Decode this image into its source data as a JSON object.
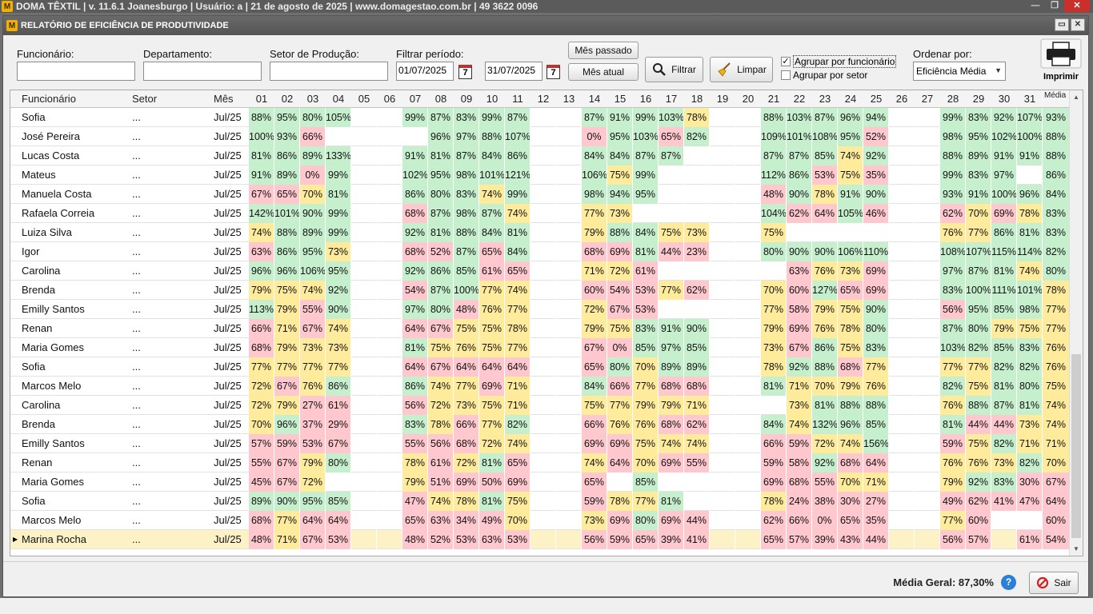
{
  "app_bar": {
    "logo": "M",
    "title": "DOMA TÊXTIL | v. 11.6.1 Joanesburgo | Usuário: a | 21 de agosto de 2025 | www.domagestao.com.br | 49 3622 0096"
  },
  "window": {
    "title": "RELATÓRIO DE EFICIÊNCIA DE PRODUTIVIDADE"
  },
  "filters": {
    "funcionario_label": "Funcionário:",
    "funcionario_value": "",
    "departamento_label": "Departamento:",
    "departamento_value": "",
    "setor_label": "Setor de Produção:",
    "setor_value": "",
    "periodo_label": "Filtrar período:",
    "date_from": "01/07/2025",
    "date_to": "31/07/2025",
    "cal_glyph": "7",
    "mes_passado": "Mês passado",
    "mes_atual": "Mês atual",
    "filtrar": "Filtrar",
    "limpar": "Limpar",
    "agrupar_func": "Agrupar por funcionário",
    "agrupar_func_checked": "✓",
    "agrupar_setor": "Agrupar por setor",
    "ordenar_label": "Ordenar por:",
    "ordenar_value": "Eficiência Média",
    "imprimir": "Imprimir"
  },
  "grid": {
    "headers": {
      "funcionario": "Funcionário",
      "setor": "Setor",
      "mes": "Mês",
      "media": "Média"
    },
    "days": [
      "01",
      "02",
      "03",
      "04",
      "05",
      "06",
      "07",
      "08",
      "09",
      "10",
      "11",
      "12",
      "13",
      "14",
      "15",
      "16",
      "17",
      "18",
      "19",
      "20",
      "21",
      "22",
      "23",
      "24",
      "25",
      "26",
      "27",
      "28",
      "29",
      "30",
      "31"
    ],
    "rows": [
      {
        "name": "Sofia",
        "setor": "...",
        "mes": "Jul/25",
        "days": [
          "88%",
          "95%",
          "80%",
          "105%",
          "",
          "",
          "99%",
          "87%",
          "83%",
          "99%",
          "87%",
          "",
          "",
          "87%",
          "91%",
          "99%",
          "103%",
          "78%",
          "",
          "",
          "88%",
          "103%",
          "87%",
          "96%",
          "94%",
          "",
          "",
          "99%",
          "83%",
          "92%",
          "107%"
        ],
        "media": "93%"
      },
      {
        "name": "José Pereira",
        "setor": "...",
        "mes": "Jul/25",
        "days": [
          "100%",
          "93%",
          "66%",
          "",
          "",
          "",
          "",
          "96%",
          "97%",
          "88%",
          "107%",
          "",
          "",
          "0%",
          "95%",
          "103%",
          "65%",
          "82%",
          "",
          "",
          "109%",
          "101%",
          "108%",
          "95%",
          "52%",
          "",
          "",
          "98%",
          "95%",
          "102%",
          "100%"
        ],
        "media": "88%"
      },
      {
        "name": "Lucas Costa",
        "setor": "...",
        "mes": "Jul/25",
        "days": [
          "81%",
          "86%",
          "89%",
          "133%",
          "",
          "",
          "91%",
          "81%",
          "87%",
          "84%",
          "86%",
          "",
          "",
          "84%",
          "84%",
          "87%",
          "87%",
          "",
          "",
          "",
          "87%",
          "87%",
          "85%",
          "74%",
          "92%",
          "",
          "",
          "88%",
          "89%",
          "91%",
          "91%"
        ],
        "media": "88%"
      },
      {
        "name": "Mateus",
        "setor": "...",
        "mes": "Jul/25",
        "days": [
          "91%",
          "89%",
          "0%",
          "99%",
          "",
          "",
          "102%",
          "95%",
          "98%",
          "101%",
          "121%",
          "",
          "",
          "106%",
          "75%",
          "99%",
          "",
          "",
          "",
          "",
          "112%",
          "86%",
          "53%",
          "75%",
          "35%",
          "",
          "",
          "99%",
          "83%",
          "97%",
          ""
        ],
        "media": "86%"
      },
      {
        "name": "Manuela Costa",
        "setor": "...",
        "mes": "Jul/25",
        "days": [
          "67%",
          "65%",
          "70%",
          "81%",
          "",
          "",
          "86%",
          "80%",
          "83%",
          "74%",
          "99%",
          "",
          "",
          "98%",
          "94%",
          "95%",
          "",
          "",
          "",
          "",
          "48%",
          "90%",
          "78%",
          "91%",
          "90%",
          "",
          "",
          "93%",
          "91%",
          "100%",
          "96%"
        ],
        "media": "84%"
      },
      {
        "name": "Rafaela Correia",
        "setor": "...",
        "mes": "Jul/25",
        "days": [
          "142%",
          "101%",
          "90%",
          "99%",
          "",
          "",
          "68%",
          "87%",
          "98%",
          "87%",
          "74%",
          "",
          "",
          "77%",
          "73%",
          "",
          "",
          "",
          "",
          "",
          "104%",
          "62%",
          "64%",
          "105%",
          "46%",
          "",
          "",
          "62%",
          "70%",
          "69%",
          "78%"
        ],
        "media": "83%"
      },
      {
        "name": "Luiza Silva",
        "setor": "...",
        "mes": "Jul/25",
        "days": [
          "74%",
          "88%",
          "89%",
          "99%",
          "",
          "",
          "92%",
          "81%",
          "88%",
          "84%",
          "81%",
          "",
          "",
          "79%",
          "88%",
          "84%",
          "75%",
          "73%",
          "",
          "",
          "75%",
          "",
          "",
          "",
          "",
          "",
          "",
          "76%",
          "77%",
          "86%",
          "81%"
        ],
        "media": "83%"
      },
      {
        "name": "Igor",
        "setor": "...",
        "mes": "Jul/25",
        "days": [
          "63%",
          "86%",
          "95%",
          "73%",
          "",
          "",
          "68%",
          "52%",
          "87%",
          "65%",
          "84%",
          "",
          "",
          "68%",
          "69%",
          "81%",
          "44%",
          "23%",
          "",
          "",
          "80%",
          "90%",
          "90%",
          "106%",
          "110%",
          "",
          "",
          "108%",
          "107%",
          "115%",
          "114%"
        ],
        "media": "82%"
      },
      {
        "name": "Carolina",
        "setor": "...",
        "mes": "Jul/25",
        "days": [
          "96%",
          "96%",
          "106%",
          "95%",
          "",
          "",
          "92%",
          "86%",
          "85%",
          "61%",
          "65%",
          "",
          "",
          "71%",
          "72%",
          "61%",
          "",
          "",
          "",
          "",
          "",
          "63%",
          "76%",
          "73%",
          "69%",
          "",
          "",
          "97%",
          "87%",
          "81%",
          "74%"
        ],
        "media": "80%"
      },
      {
        "name": "Brenda",
        "setor": "...",
        "mes": "Jul/25",
        "days": [
          "79%",
          "75%",
          "74%",
          "92%",
          "",
          "",
          "54%",
          "87%",
          "100%",
          "77%",
          "74%",
          "",
          "",
          "60%",
          "54%",
          "53%",
          "77%",
          "62%",
          "",
          "",
          "70%",
          "60%",
          "127%",
          "65%",
          "69%",
          "",
          "",
          "83%",
          "100%",
          "111%",
          "101%"
        ],
        "media": "78%"
      },
      {
        "name": "Emilly Santos",
        "setor": "...",
        "mes": "Jul/25",
        "days": [
          "113%",
          "79%",
          "55%",
          "90%",
          "",
          "",
          "97%",
          "80%",
          "48%",
          "76%",
          "77%",
          "",
          "",
          "72%",
          "67%",
          "53%",
          "",
          "",
          "",
          "",
          "77%",
          "58%",
          "79%",
          "75%",
          "90%",
          "",
          "",
          "56%",
          "95%",
          "85%",
          "98%"
        ],
        "media": "77%"
      },
      {
        "name": "Renan",
        "setor": "...",
        "mes": "Jul/25",
        "days": [
          "66%",
          "71%",
          "67%",
          "74%",
          "",
          "",
          "64%",
          "67%",
          "75%",
          "75%",
          "78%",
          "",
          "",
          "79%",
          "75%",
          "83%",
          "91%",
          "90%",
          "",
          "",
          "79%",
          "69%",
          "76%",
          "78%",
          "80%",
          "",
          "",
          "87%",
          "80%",
          "79%",
          "75%"
        ],
        "media": "77%"
      },
      {
        "name": "Maria Gomes",
        "setor": "...",
        "mes": "Jul/25",
        "days": [
          "68%",
          "79%",
          "73%",
          "73%",
          "",
          "",
          "81%",
          "75%",
          "76%",
          "75%",
          "77%",
          "",
          "",
          "67%",
          "0%",
          "85%",
          "97%",
          "85%",
          "",
          "",
          "73%",
          "67%",
          "86%",
          "75%",
          "83%",
          "",
          "",
          "103%",
          "82%",
          "85%",
          "83%"
        ],
        "media": "76%"
      },
      {
        "name": "Sofia",
        "setor": "...",
        "mes": "Jul/25",
        "days": [
          "77%",
          "77%",
          "77%",
          "77%",
          "",
          "",
          "64%",
          "67%",
          "64%",
          "64%",
          "64%",
          "",
          "",
          "65%",
          "80%",
          "70%",
          "89%",
          "89%",
          "",
          "",
          "78%",
          "92%",
          "88%",
          "68%",
          "77%",
          "",
          "",
          "77%",
          "77%",
          "82%",
          "82%"
        ],
        "media": "76%"
      },
      {
        "name": "Marcos Melo",
        "setor": "...",
        "mes": "Jul/25",
        "days": [
          "72%",
          "67%",
          "76%",
          "86%",
          "",
          "",
          "86%",
          "74%",
          "77%",
          "69%",
          "71%",
          "",
          "",
          "84%",
          "66%",
          "77%",
          "68%",
          "68%",
          "",
          "",
          "81%",
          "71%",
          "70%",
          "79%",
          "76%",
          "",
          "",
          "82%",
          "75%",
          "81%",
          "80%"
        ],
        "media": "75%"
      },
      {
        "name": "Carolina",
        "setor": "...",
        "mes": "Jul/25",
        "days": [
          "72%",
          "79%",
          "27%",
          "61%",
          "",
          "",
          "56%",
          "72%",
          "73%",
          "75%",
          "71%",
          "",
          "",
          "75%",
          "77%",
          "79%",
          "79%",
          "71%",
          "",
          "",
          "",
          "73%",
          "81%",
          "88%",
          "88%",
          "",
          "",
          "76%",
          "88%",
          "87%",
          "81%"
        ],
        "media": "74%"
      },
      {
        "name": "Brenda",
        "setor": "...",
        "mes": "Jul/25",
        "days": [
          "70%",
          "96%",
          "37%",
          "29%",
          "",
          "",
          "83%",
          "78%",
          "66%",
          "77%",
          "82%",
          "",
          "",
          "66%",
          "76%",
          "76%",
          "68%",
          "62%",
          "",
          "",
          "84%",
          "74%",
          "132%",
          "96%",
          "85%",
          "",
          "",
          "81%",
          "44%",
          "44%",
          "73%"
        ],
        "media": "74%"
      },
      {
        "name": "Emilly Santos",
        "setor": "...",
        "mes": "Jul/25",
        "days": [
          "57%",
          "59%",
          "53%",
          "67%",
          "",
          "",
          "55%",
          "56%",
          "68%",
          "72%",
          "74%",
          "",
          "",
          "69%",
          "69%",
          "75%",
          "74%",
          "74%",
          "",
          "",
          "66%",
          "59%",
          "72%",
          "74%",
          "156%",
          "",
          "",
          "59%",
          "75%",
          "82%",
          "71%"
        ],
        "media": "71%"
      },
      {
        "name": "Renan",
        "setor": "...",
        "mes": "Jul/25",
        "days": [
          "55%",
          "67%",
          "79%",
          "80%",
          "",
          "",
          "78%",
          "61%",
          "72%",
          "81%",
          "65%",
          "",
          "",
          "74%",
          "64%",
          "70%",
          "69%",
          "55%",
          "",
          "",
          "59%",
          "58%",
          "92%",
          "68%",
          "64%",
          "",
          "",
          "76%",
          "76%",
          "73%",
          "82%"
        ],
        "media": "70%"
      },
      {
        "name": "Maria Gomes",
        "setor": "...",
        "mes": "Jul/25",
        "days": [
          "45%",
          "67%",
          "72%",
          "",
          "",
          "",
          "79%",
          "51%",
          "69%",
          "50%",
          "69%",
          "",
          "",
          "65%",
          "",
          "85%",
          "",
          "",
          "",
          "",
          "69%",
          "68%",
          "55%",
          "70%",
          "71%",
          "",
          "",
          "79%",
          "92%",
          "83%",
          "30%"
        ],
        "media": "67%"
      },
      {
        "name": "Sofia",
        "setor": "...",
        "mes": "Jul/25",
        "days": [
          "89%",
          "90%",
          "95%",
          "85%",
          "",
          "",
          "47%",
          "74%",
          "78%",
          "81%",
          "75%",
          "",
          "",
          "59%",
          "78%",
          "77%",
          "81%",
          "",
          "",
          "",
          "78%",
          "24%",
          "38%",
          "30%",
          "27%",
          "",
          "",
          "49%",
          "62%",
          "41%",
          "47%"
        ],
        "media": "64%"
      },
      {
        "name": "Marcos Melo",
        "setor": "...",
        "mes": "Jul/25",
        "days": [
          "68%",
          "77%",
          "64%",
          "64%",
          "",
          "",
          "65%",
          "63%",
          "34%",
          "49%",
          "70%",
          "",
          "",
          "73%",
          "69%",
          "80%",
          "69%",
          "44%",
          "",
          "",
          "62%",
          "66%",
          "0%",
          "65%",
          "35%",
          "",
          "",
          "77%",
          "60%",
          "",
          ""
        ],
        "media": "60%"
      },
      {
        "name": "Marina Rocha",
        "setor": "...",
        "mes": "Jul/25",
        "days": [
          "48%",
          "71%",
          "67%",
          "53%",
          "",
          "",
          "48%",
          "52%",
          "53%",
          "63%",
          "53%",
          "",
          "",
          "56%",
          "59%",
          "65%",
          "39%",
          "41%",
          "",
          "",
          "65%",
          "57%",
          "39%",
          "43%",
          "44%",
          "",
          "",
          "56%",
          "57%",
          "",
          "61%"
        ],
        "media": "54%"
      }
    ],
    "selected_row": 22,
    "row_marker": "▶"
  },
  "footer": {
    "media_geral": "Média Geral: 87,30%",
    "help": "?",
    "sair": "Sair"
  },
  "colors": {
    "green": "#c6efce",
    "yellow": "#ffeb9c",
    "red": "#ffc7ce"
  },
  "icons": {
    "print": "printer-icon",
    "filter": "magnifier-icon",
    "clear": "broom-icon",
    "exit": "no-entry-icon",
    "help": "help-icon"
  }
}
